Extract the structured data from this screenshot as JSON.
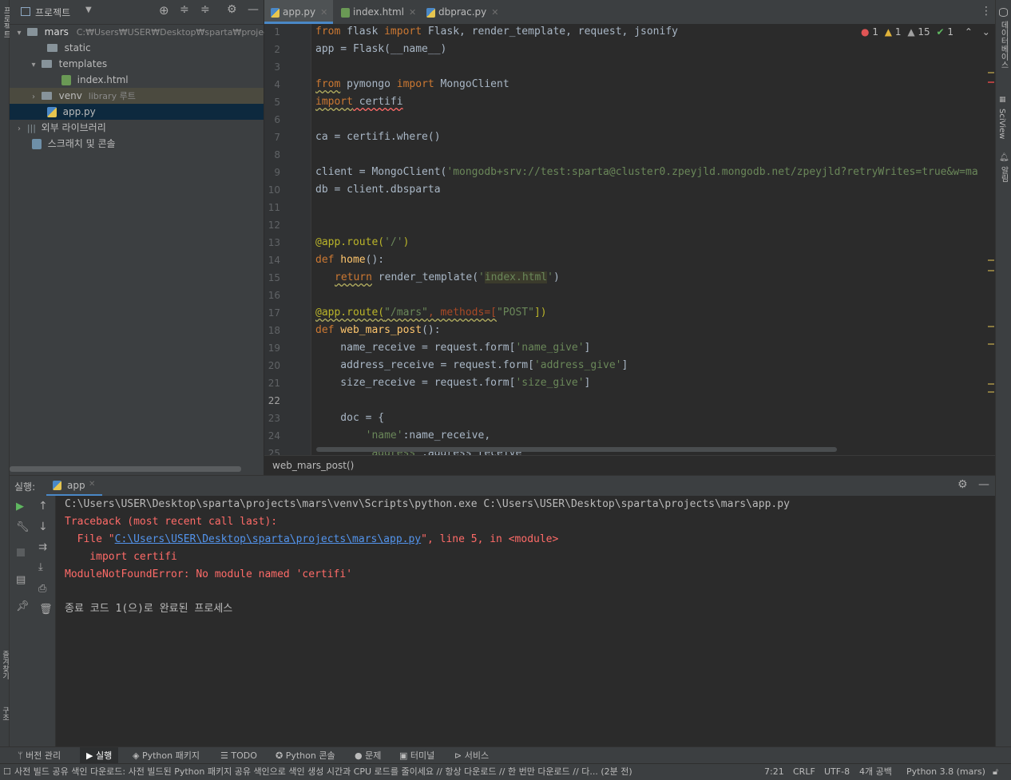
{
  "project_panel": {
    "title": "프로젝트",
    "tree": [
      {
        "label": "mars",
        "detail": "C:₩Users₩USER₩Desktop₩sparta₩projects₩"
      },
      {
        "label": "static"
      },
      {
        "label": "templates"
      },
      {
        "label": "index.html"
      },
      {
        "label": "venv",
        "detail": "library 루트"
      },
      {
        "label": "app.py"
      },
      {
        "label": "외부 라이브러리"
      },
      {
        "label": "스크래치 및 콘솔"
      }
    ]
  },
  "tabs": [
    {
      "label": "app.py"
    },
    {
      "label": "index.html"
    },
    {
      "label": "dbprac.py"
    }
  ],
  "inspections": {
    "errors": "1",
    "warnings": "1",
    "weak_warnings": "15",
    "typos": "1"
  },
  "editor": {
    "line_numbers": [
      "1",
      "2",
      "3",
      "4",
      "5",
      "6",
      "7",
      "8",
      "9",
      "10",
      "11",
      "12",
      "13",
      "14",
      "15",
      "16",
      "17",
      "18",
      "19",
      "20",
      "21",
      "22",
      "23",
      "24",
      "25"
    ],
    "lines": {
      "l1_from": "from",
      "l1_mod": " flask ",
      "l1_import": "import",
      "l1_rest": " Flask, render_template, request, jsonify",
      "l2": "app = Flask(__name__)",
      "l4_from": "from",
      "l4_mod": " pymongo ",
      "l4_import": "import",
      "l4_rest": " MongoClient",
      "l5_import": "import",
      "l5_rest": " certifi",
      "l7": "ca = certifi.where()",
      "l9_pre": "client = MongoClient(",
      "l9_str": "'mongodb+srv://test:sparta@cluster0.zpeyjld.mongodb.net/zpeyjld?retryWrites=true&w=ma",
      "l10": "db = client.dbsparta",
      "l13_dec": "@app.route(",
      "l13_str": "'/'",
      "l13_end": ")",
      "l14_def": "def",
      "l14_fn": " home",
      "l14_end": "():",
      "l15_ret": "return",
      "l15_mid": " render_template(",
      "l15_q1": "'",
      "l15_str": "index.html",
      "l15_q2": "'",
      "l15_end": ")",
      "l17_dec": "@app.route(",
      "l17_str": "\"/mars\"",
      "l17_mid": ", methods=[",
      "l17_str2": "\"POST\"",
      "l17_end": "])",
      "l18_def": "def",
      "l18_fn": " web_mars_post",
      "l18_end": "():",
      "l19_pre": "    name_receive = request.form[",
      "l19_str": "'name_give'",
      "l19_end": "]",
      "l20_pre": "    address_receive = request.form[",
      "l20_str": "'address_give'",
      "l20_end": "]",
      "l21_pre": "    size_receive = request.form[",
      "l21_str": "'size_give'",
      "l21_end": "]",
      "l23": "    doc = {",
      "l24_str": "        'name'",
      "l24_rest": ":name_receive,",
      "l25_str": "        'address'",
      "l25_rest": ":address_receive"
    },
    "breadcrumb": "web_mars_post()"
  },
  "run_panel": {
    "label": "실행:",
    "tab": "app",
    "console": {
      "cmd": "C:\\Users\\USER\\Desktop\\sparta\\projects\\mars\\venv\\Scripts\\python.exe C:\\Users\\USER\\Desktop\\sparta\\projects\\mars\\app.py",
      "traceback": "Traceback (most recent call last):",
      "file_pre": "  File \"",
      "file_link": "C:\\Users\\USER\\Desktop\\sparta\\projects\\mars\\app.py",
      "file_post": "\", line 5, in <module>",
      "code": "    import certifi",
      "error": "ModuleNotFoundError: No module named 'certifi'",
      "exit": "종료 코드 1(으)로 완료된 프로세스"
    }
  },
  "tool_windows": [
    {
      "label": "버전 관리"
    },
    {
      "label": "실행"
    },
    {
      "label": "Python 패키지"
    },
    {
      "label": "TODO"
    },
    {
      "label": "Python 콘솔"
    },
    {
      "label": "문제"
    },
    {
      "label": "터미널"
    },
    {
      "label": "서비스"
    }
  ],
  "side_labels": {
    "left_top": "프로젝트",
    "left_bottom1": "즐겨찾기",
    "left_bottom2": "구조",
    "right1": "데이터베이스",
    "right2": "SciView",
    "right3": "알림"
  },
  "status_bar": {
    "message": "사전 빌드 공유 색인 다운로드: 사전 빌드된 Python 패키지 공유 색인으로 색인 생성 시간과 CPU 로드를 줄이세요 // 항상 다운로드 // 한 번만 다운로드 // 다... (2분 전)",
    "position": "7:21",
    "line_sep": "CRLF",
    "encoding": "UTF-8",
    "indent": "4개 공백",
    "interpreter": "Python 3.8 (mars)"
  },
  "colors": {
    "error": "#ff6b68",
    "link": "#5394ec",
    "accent": "#4a88c7",
    "keyword": "#cc7832",
    "string": "#6a8759"
  }
}
